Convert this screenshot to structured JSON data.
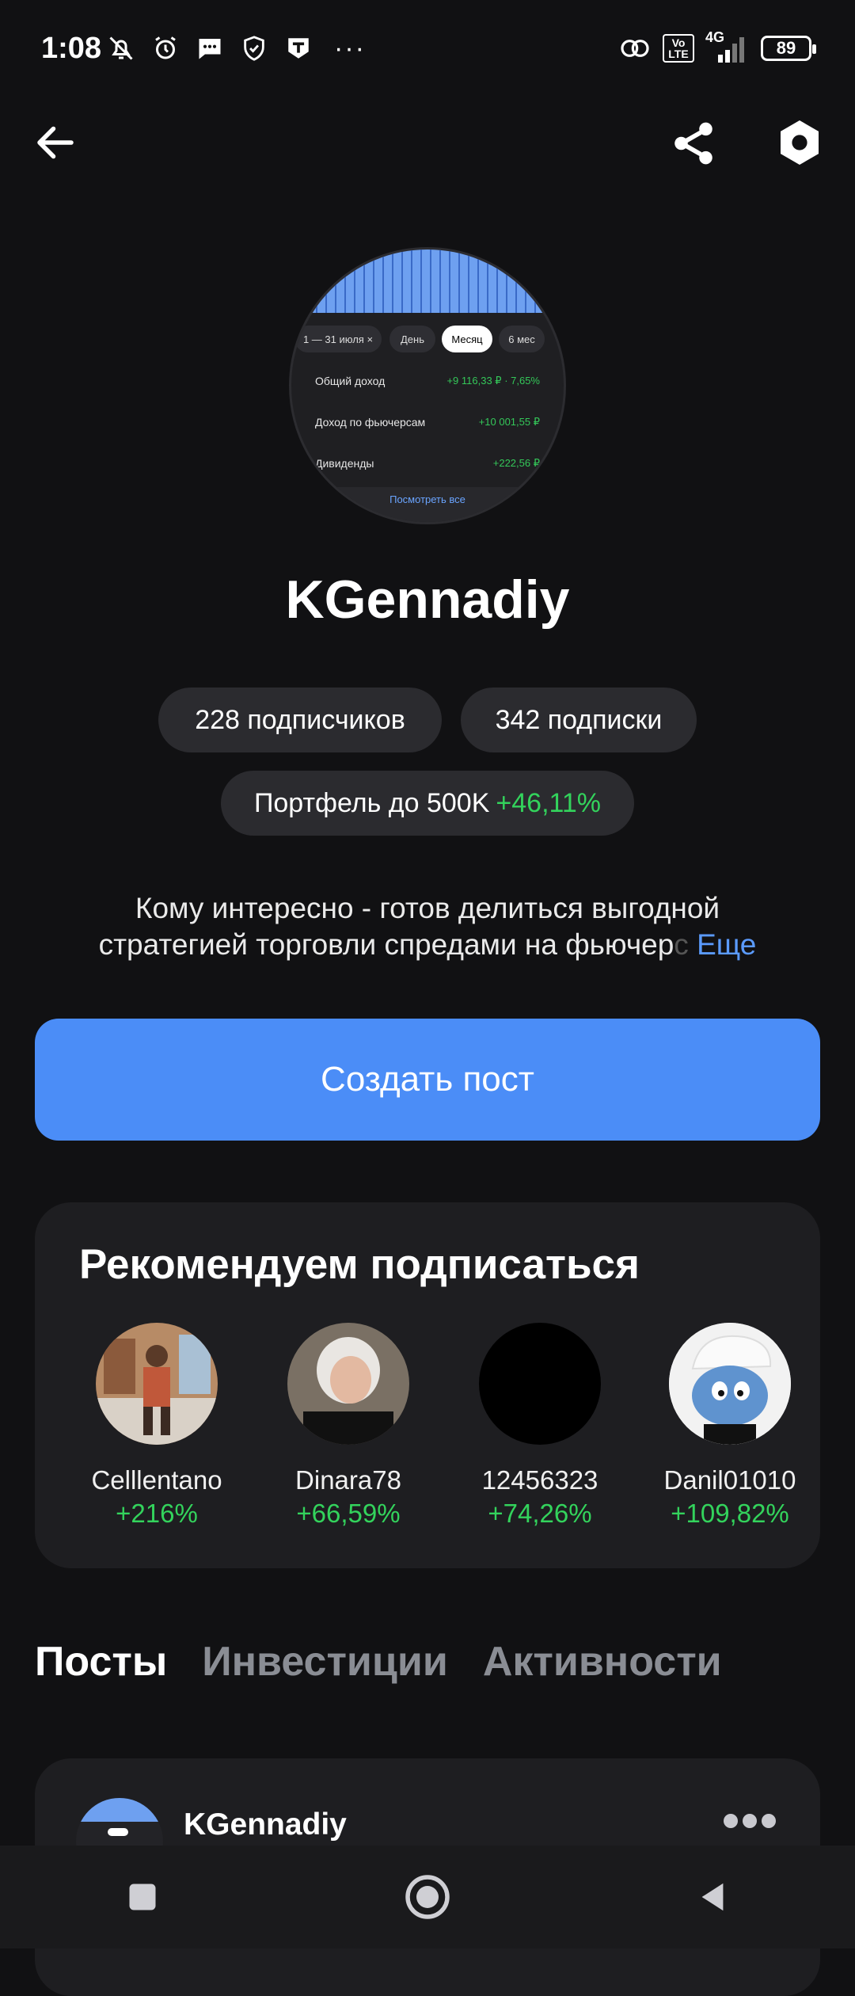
{
  "status_bar": {
    "time": "1:08",
    "icons_left": [
      "muted-bell-icon",
      "alarm-icon",
      "message-icon",
      "shield-icon",
      "t-app-icon"
    ],
    "more": "···",
    "network": "4G",
    "volte": "Vo LTE",
    "battery": "89"
  },
  "avatar_preview": {
    "date_range": "1 — 31 июля",
    "chips": [
      "День",
      "Месяц",
      "6 мес"
    ],
    "rows": [
      {
        "label": "Общий доход",
        "value": "+9 116,33 ₽ · 7,65%"
      },
      {
        "label": "Доход по фьючерсам",
        "value": "+10 001,55 ₽"
      },
      {
        "label": "Дивиденды",
        "value": "+222,56 ₽"
      }
    ],
    "see_all": "Посмотреть все"
  },
  "profile": {
    "username": "KGennadiy",
    "subscribers": "228 подписчиков",
    "subscriptions": "342 подписки",
    "portfolio_label": "Портфель до 500K",
    "portfolio_gain": "+46,11%",
    "bio_line1": "Кому интересно - готов делиться выгодной",
    "bio_line2": "стратегией торговли спредами на фьючер",
    "bio_fade": "с",
    "bio_more": "Еще"
  },
  "create_post_label": "Создать пост",
  "recommend": {
    "title": "Рекомендуем подписаться",
    "users": [
      {
        "name": "Celllentano",
        "gain": "+216%"
      },
      {
        "name": "Dinara78",
        "gain": "+66,59%"
      },
      {
        "name": "12456323",
        "gain": "+74,26%"
      },
      {
        "name": "Danil01010",
        "gain": "+109,82%"
      }
    ]
  },
  "tabs": [
    "Посты",
    "Инвестиции",
    "Активности"
  ],
  "post": {
    "author": "KGennadiy"
  },
  "colors": {
    "accent": "#4b8df7",
    "gain": "#33d35c",
    "card": "#1e1e21"
  }
}
